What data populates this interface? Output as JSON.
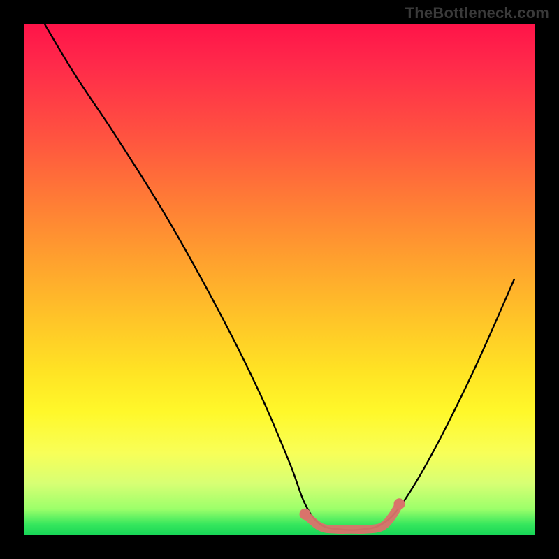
{
  "watermark": "TheBottleneck.com",
  "chart_data": {
    "type": "line",
    "title": "",
    "xlabel": "",
    "ylabel": "",
    "xlim": [
      0,
      100
    ],
    "ylim": [
      0,
      100
    ],
    "series": [
      {
        "name": "curve",
        "color": "#000000",
        "x": [
          4,
          10,
          18,
          28,
          38,
          46,
          52,
          55,
          58,
          62,
          66,
          70,
          74,
          80,
          88,
          96
        ],
        "y": [
          100,
          90,
          78,
          62,
          44,
          28,
          14,
          6,
          2,
          1,
          1,
          2,
          6,
          16,
          32,
          50
        ]
      }
    ],
    "highlight": {
      "name": "bottom-marker",
      "color": "#d9736b",
      "points_x": [
        55,
        58,
        61,
        64,
        67,
        70,
        72,
        73.5
      ],
      "points_y": [
        4,
        1.5,
        1,
        1,
        1,
        1.5,
        3.5,
        6
      ]
    }
  }
}
